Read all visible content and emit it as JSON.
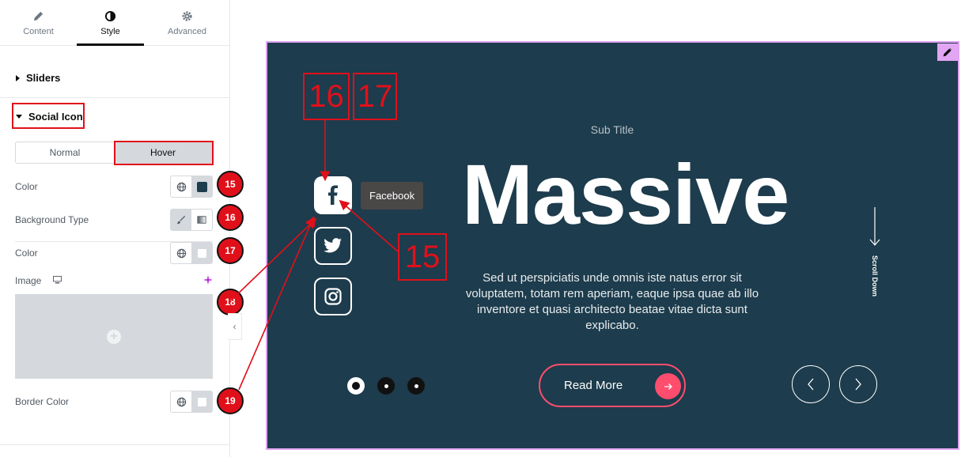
{
  "tabs": [
    {
      "label": "Content",
      "icon": "pencil-icon"
    },
    {
      "label": "Style",
      "icon": "contrast-icon"
    },
    {
      "label": "Advanced",
      "icon": "gear-icon"
    }
  ],
  "active_tab": "Style",
  "sections": {
    "sliders": "Sliders",
    "social_icon": "Social Icon"
  },
  "state_switch": {
    "normal": "Normal",
    "hover": "Hover",
    "selected": "Hover"
  },
  "controls": {
    "color": "Color",
    "background_type": "Background Type",
    "bg_color": "Color",
    "image": "Image",
    "border_color": "Border Color"
  },
  "colors": {
    "icon_hover_color": "#1d3c4d",
    "bg_color": "#ffffff",
    "border_color": "#ffffff",
    "accent_red": "#e0101a",
    "button_pink": "#ff4d6d"
  },
  "badges": [
    "15",
    "16",
    "17",
    "18",
    "19"
  ],
  "preview": {
    "subtitle": "Sub Title",
    "title": "Massive",
    "description": "Sed ut perspiciatis unde omnis iste natus error sit voluptatem, totam rem aperiam, eaque ipsa quae ab illo inventore et quasi architecto beatae vitae dicta sunt explicabo.",
    "tooltip": "Facebook",
    "read_more": "Read More",
    "scroll_down": "Scroll Down",
    "social_icons": [
      "facebook-icon",
      "twitter-icon",
      "instagram-icon"
    ],
    "slide_count": 3,
    "active_slide": 1
  },
  "annotations": {
    "a16": "16",
    "a17": "17",
    "a15": "15"
  }
}
